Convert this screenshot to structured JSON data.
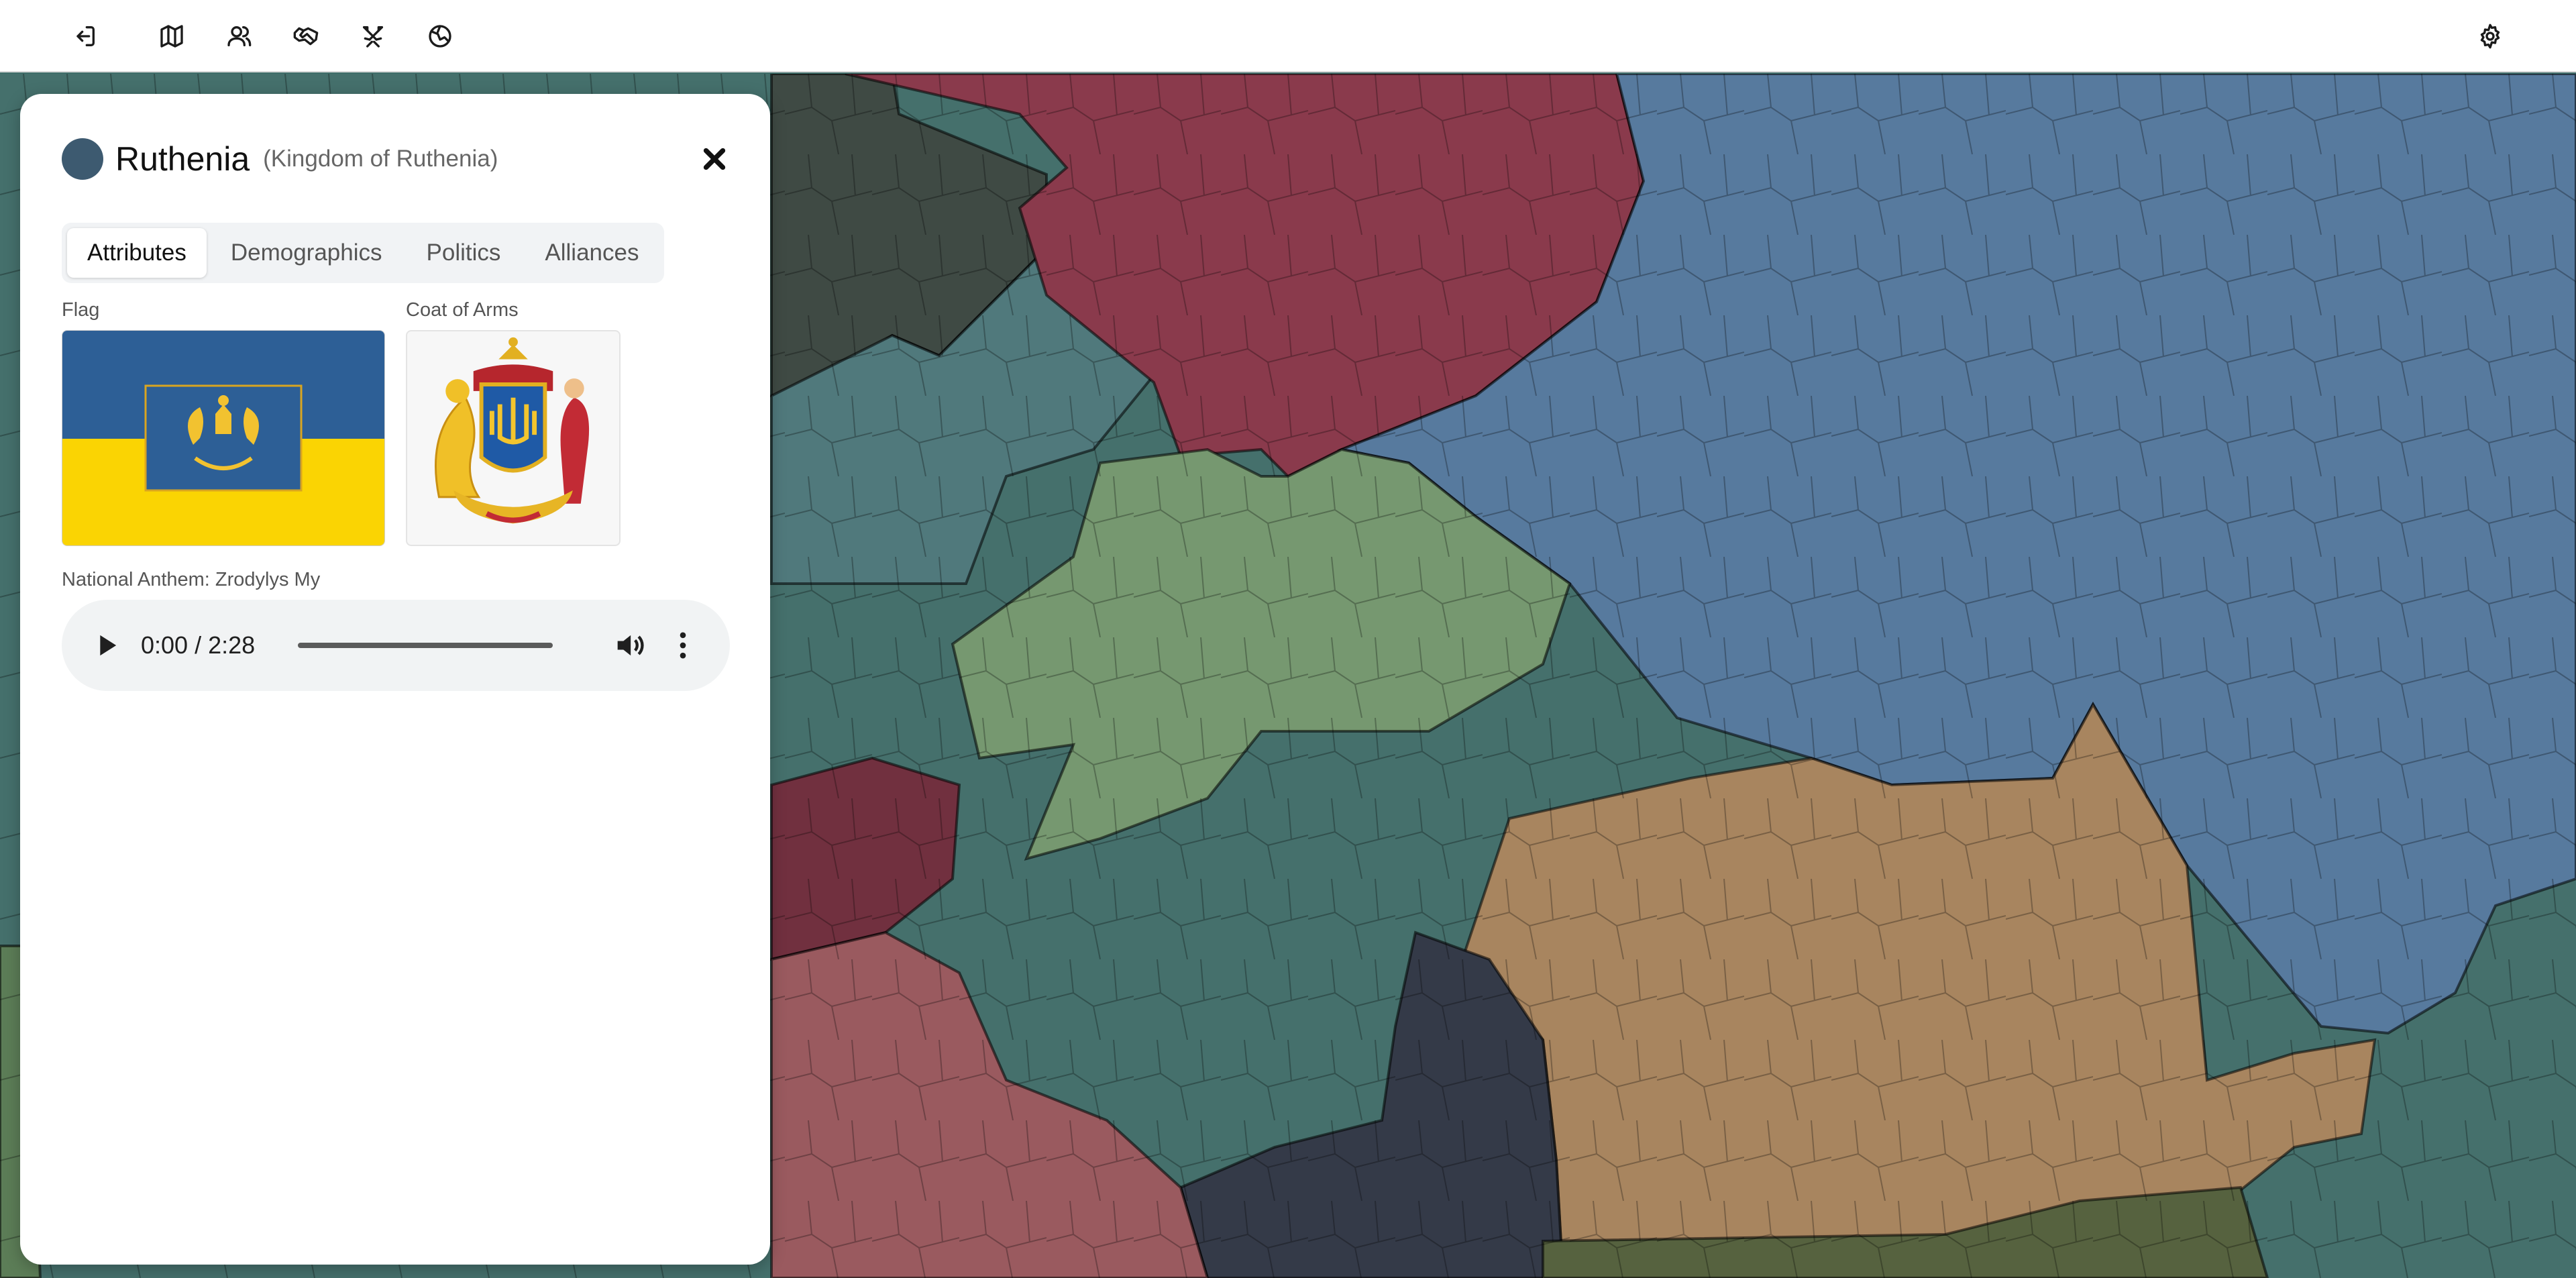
{
  "toolbar": {
    "left_icons": [
      "exit-icon",
      "map-icon",
      "users-icon",
      "handshake-icon",
      "crossed-swords-icon",
      "globe-icon"
    ],
    "right_icon": "gear-icon"
  },
  "panel": {
    "country_name": "Ruthenia",
    "country_full_name": "(Kingdom of Ruthenia)",
    "country_color": "#3d5a70",
    "tabs": [
      {
        "label": "Attributes",
        "active": true
      },
      {
        "label": "Demographics",
        "active": false
      },
      {
        "label": "Politics",
        "active": false
      },
      {
        "label": "Alliances",
        "active": false
      }
    ],
    "flag_label": "Flag",
    "coat_of_arms_label": "Coat of Arms",
    "anthem_label": "National Anthem: Zrodylys My",
    "audio": {
      "time": "0:00 / 2:28",
      "progress": 0
    }
  },
  "flag": {
    "top_color": "#2d5f96",
    "bottom_color": "#fad403"
  },
  "map": {
    "region_colors": {
      "ruthenia": "#45706c",
      "red_north": "#8a3a4c",
      "blue_east": "#577a9e",
      "green_center": "#769870",
      "tan_southeast": "#a8855f",
      "dark_west": "#3f4a44",
      "teal_northwest": "#50797c",
      "crimson_west": "#71303f",
      "rose_southwest": "#9a5a5f",
      "navy_south": "#343a48",
      "olive_south": "#56623f",
      "green_far_west": "#5c7d57"
    }
  }
}
